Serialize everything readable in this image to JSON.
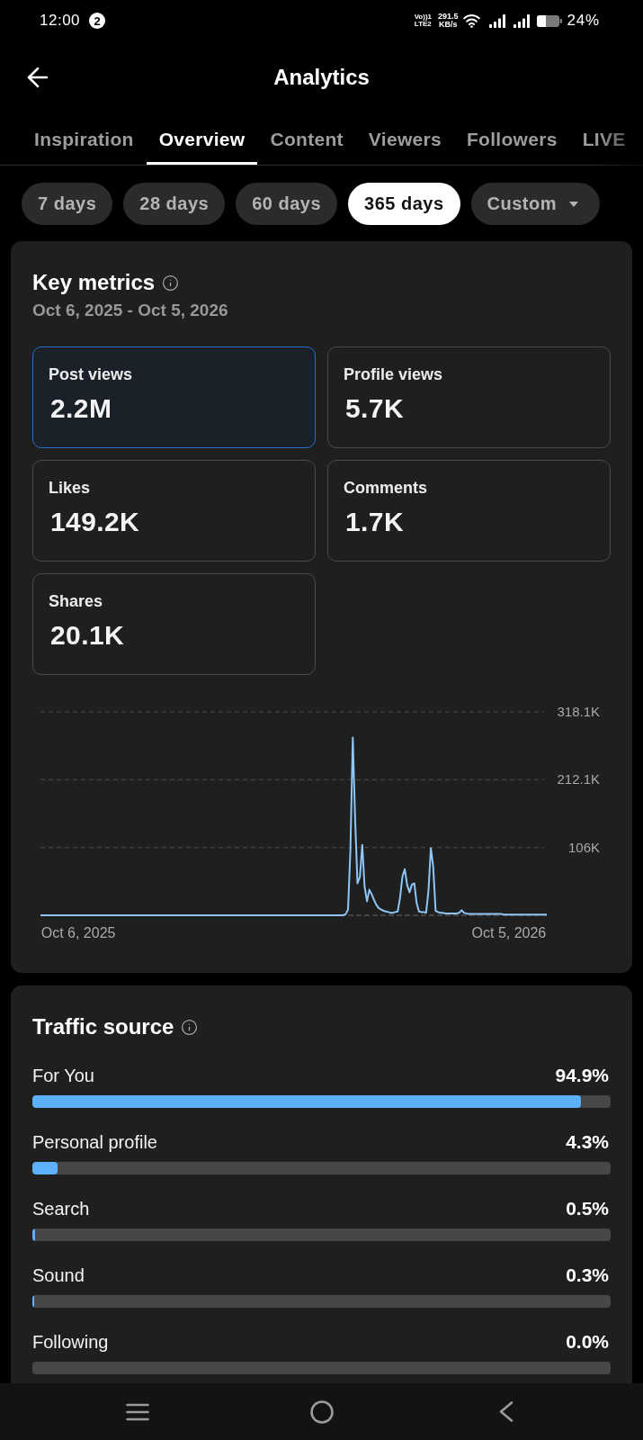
{
  "status_bar": {
    "time": "12:00",
    "notification_count": "2",
    "network": [
      "Vo))1",
      "LTE2"
    ],
    "data_speed": [
      "291.5",
      "KB/s"
    ],
    "battery": "24%"
  },
  "header": {
    "title": "Analytics"
  },
  "tabs": [
    {
      "label": "Inspiration",
      "selected": false
    },
    {
      "label": "Overview",
      "selected": true
    },
    {
      "label": "Content",
      "selected": false
    },
    {
      "label": "Viewers",
      "selected": false
    },
    {
      "label": "Followers",
      "selected": false
    },
    {
      "label": "LIVE",
      "selected": false
    }
  ],
  "date_ranges": [
    {
      "label": "7 days",
      "kind": "preset",
      "selected": false
    },
    {
      "label": "28 days",
      "kind": "preset",
      "selected": false
    },
    {
      "label": "60 days",
      "kind": "preset",
      "selected": false
    },
    {
      "label": "365 days",
      "kind": "preset",
      "selected": true
    },
    {
      "label": "Custom",
      "kind": "dropdown",
      "selected": false
    }
  ],
  "key_metrics": {
    "title": "Key metrics",
    "date_range": "Oct 6, 2025 - Oct 5, 2026",
    "metrics": [
      {
        "label": "Post views",
        "value": "2.2M",
        "selected": true
      },
      {
        "label": "Profile views",
        "value": "5.7K",
        "selected": false
      },
      {
        "label": "Likes",
        "value": "149.2K",
        "selected": false
      },
      {
        "label": "Comments",
        "value": "1.7K",
        "selected": false
      },
      {
        "label": "Shares",
        "value": "20.1K",
        "selected": false
      }
    ],
    "chart_data": {
      "type": "line",
      "categories": [
        null,
        null,
        null,
        null,
        null,
        null,
        null,
        null,
        null,
        null,
        null,
        null,
        null,
        null,
        null,
        null,
        "Oct 6, 2025",
        null,
        null,
        null,
        null,
        null,
        null,
        null,
        null,
        null,
        null,
        null,
        null,
        null,
        null,
        null,
        null,
        null,
        null,
        null,
        null,
        null,
        null,
        null,
        null,
        null,
        null,
        null,
        null,
        null,
        null,
        null,
        null,
        null,
        null,
        null,
        null,
        null,
        null,
        null,
        null,
        null,
        null,
        null,
        null,
        null,
        null,
        null,
        null,
        null,
        null,
        null,
        null,
        null,
        null,
        null,
        null,
        null,
        null,
        null,
        null,
        null,
        null,
        null,
        null,
        null,
        null,
        null,
        null,
        null,
        null,
        null,
        null,
        null,
        null,
        null,
        null,
        null,
        null,
        null,
        null,
        null,
        null,
        null,
        null,
        null,
        null,
        null,
        null,
        null,
        null,
        null,
        null,
        null,
        null,
        null,
        null,
        null,
        null,
        null,
        null,
        null,
        null,
        null,
        null,
        null,
        null,
        null,
        null,
        null,
        null,
        null,
        null,
        null,
        null,
        null,
        null,
        null,
        null,
        null,
        null,
        null,
        null,
        null,
        null,
        null,
        null,
        null,
        null,
        null,
        null,
        null,
        null,
        null,
        null,
        null,
        null,
        null,
        null,
        null,
        null,
        null,
        null,
        null,
        null,
        null,
        null,
        null,
        null,
        null,
        null,
        null,
        null,
        null,
        null,
        null,
        null,
        null,
        null,
        null,
        null,
        null,
        null,
        null,
        null,
        null,
        null,
        null,
        null,
        null,
        null,
        null,
        null,
        null,
        null,
        null,
        null,
        null,
        null,
        null,
        null,
        null,
        "Oct 5, 2026",
        null,
        null,
        null,
        null,
        null,
        null,
        null,
        null,
        null,
        null,
        null,
        null,
        null,
        null,
        null,
        null
      ],
      "series": [
        {
          "color": "#8fc6f5",
          "values": [
            0,
            0,
            0,
            0,
            0,
            0,
            0,
            0,
            0,
            0,
            0,
            0,
            0,
            0,
            0,
            0,
            0,
            0,
            0,
            0,
            0,
            0,
            0,
            0,
            0,
            0,
            0,
            0,
            0,
            0,
            0,
            0,
            0,
            0,
            0,
            0,
            0,
            0,
            0,
            0,
            0,
            0,
            0,
            0,
            0,
            0,
            0,
            0,
            0,
            0,
            0,
            0,
            0,
            0,
            0,
            0,
            0,
            0,
            0,
            0,
            0,
            0,
            0,
            0,
            0,
            0,
            0,
            0,
            0,
            0,
            0,
            0,
            0,
            0,
            0,
            0,
            0,
            0,
            0,
            0,
            0,
            0,
            0,
            0,
            0,
            0,
            0,
            0,
            0,
            0,
            0,
            0,
            0,
            0,
            0,
            0,
            0,
            0,
            0,
            0,
            0,
            0,
            0,
            0,
            0,
            0,
            0,
            0,
            0,
            0,
            0,
            0,
            0,
            0,
            0,
            0,
            0,
            0,
            0,
            0,
            0,
            0,
            0,
            0,
            0,
            0,
            0,
            0,
            0,
            2000,
            9000,
            100000,
            278000,
            150000,
            50000,
            60000,
            110000,
            45000,
            22000,
            40000,
            33000,
            24000,
            16000,
            11000,
            9000,
            7000,
            6000,
            5000,
            4000,
            4000,
            5000,
            6000,
            28000,
            61000,
            72000,
            47000,
            36000,
            48000,
            50000,
            19000,
            6000,
            5000,
            5000,
            4000,
            39000,
            105000,
            76000,
            7000,
            5000,
            4000,
            4000,
            3000,
            3000,
            3000,
            3000,
            3000,
            3000,
            4000,
            8000,
            4000,
            3000,
            2000,
            2000,
            2000,
            2000,
            2000,
            2000,
            2000,
            2000,
            2000,
            2000,
            2000,
            2000,
            2000,
            2000,
            2000,
            1000,
            1000,
            1000,
            1000,
            1000,
            1000,
            1000,
            1000,
            1000,
            1000,
            1000,
            1000,
            1000,
            1000,
            1000,
            1000,
            1000,
            1000,
            1000
          ]
        }
      ],
      "ylim": [
        0,
        318100
      ],
      "yticks": [
        {
          "value": 106000,
          "label": "106K"
        },
        {
          "value": 212100,
          "label": "212.1K"
        },
        {
          "value": 318100,
          "label": "318.1K"
        }
      ]
    }
  },
  "traffic_source": {
    "title": "Traffic source",
    "sources": [
      {
        "label": "For You",
        "value": "94.9%",
        "level": 0.949
      },
      {
        "label": "Personal profile",
        "value": "4.3%",
        "level": 0.043
      },
      {
        "label": "Search",
        "value": "0.5%",
        "level": 0.005
      },
      {
        "label": "Sound",
        "value": "0.3%",
        "level": 0.003
      },
      {
        "label": "Following",
        "value": "0.0%"
      }
    ]
  }
}
